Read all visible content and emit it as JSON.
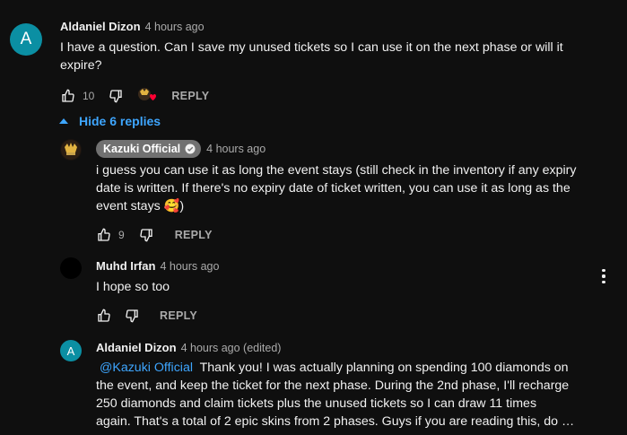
{
  "comments": [
    {
      "author": "Aldaniel Dizon",
      "time": "4 hours ago",
      "avatar_letter": "A",
      "avatar_color": "#0b8fa3",
      "text": "I have a question. Can I save my unused tickets so I can use it on the next phase or will it expire?",
      "likes": "10",
      "reply_label": "REPLY",
      "toggle_label": "Hide 6 replies"
    },
    {
      "author": "Kazuki Official",
      "time": "4 hours ago",
      "text": "i guess you can use it as long the event stays (still check in the inventory if any expiry date is written. If there's no expiry date of ticket written, you can use it as long as the event stays 🥰)",
      "likes": "9",
      "reply_label": "REPLY"
    },
    {
      "author": "Muhd Irfan",
      "time": "4 hours ago",
      "text": "I hope so too",
      "reply_label": "REPLY"
    },
    {
      "author": "Aldaniel Dizon",
      "time": "4 hours ago (edited)",
      "avatar_letter": "A",
      "avatar_color": "#0b8fa3",
      "mention": "@Kazuki Official",
      "text_line1": "Thank you! I was actually planning on spending 100 diamonds on",
      "text_line2": "the event, and keep the ticket for the next phase. During the 2nd phase, I'll recharge",
      "text_line3": "250 diamonds and claim tickets plus the unused tickets so I can draw 11 times",
      "text_line4": "again. That's a total of 2 epic skins from 2 phases. Guys if you are reading this, do …"
    }
  ],
  "icons": {
    "like": "thumbs-up-icon",
    "dislike": "thumbs-down-icon",
    "heart": "creator-heart-icon",
    "verified": "verified-check-icon",
    "caret": "caret-up-icon",
    "more": "more-vert-icon"
  },
  "colors": {
    "background": "#0f0f0f",
    "link": "#3ea6ff",
    "secondary_text": "#aaaaaa",
    "heart": "#ff0033",
    "badge": "#717171"
  }
}
